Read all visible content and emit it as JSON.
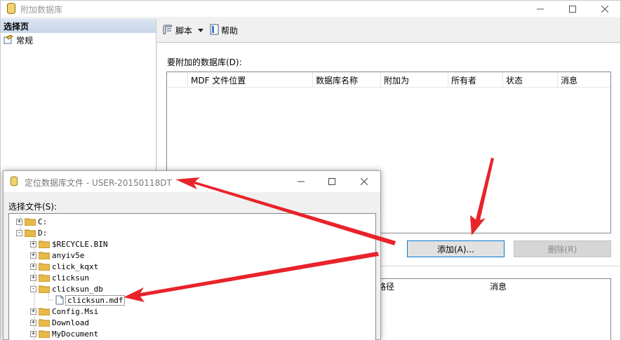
{
  "main_window": {
    "title": "附加数据库",
    "left_pane": {
      "header": "选择页",
      "items": [
        {
          "label": "常规",
          "icon": "general-page-icon"
        }
      ]
    },
    "toolbar": {
      "script_label": "脚本",
      "help_label": "帮助"
    },
    "db_section_label": "要附加的数据库(D):",
    "columns": [
      "MDF 文件位置",
      "数据库名称",
      "附加为",
      "所有者",
      "状态",
      "消息"
    ],
    "add_button": "添加(A)...",
    "remove_button": "删除(R)",
    "detail_columns": [
      "路径",
      "消息"
    ]
  },
  "dialog": {
    "title": "定位数据库文件 - USER-20150118DT",
    "select_label": "选择文件(S):",
    "tree": [
      {
        "label": "C:",
        "expander": "+",
        "type": "folder"
      },
      {
        "label": "D:",
        "expander": "-",
        "type": "folder"
      },
      {
        "label": "$RECYCLE.BIN",
        "expander": "+",
        "type": "folder"
      },
      {
        "label": "anyiv5e",
        "expander": "+",
        "type": "folder"
      },
      {
        "label": "click_kqxt",
        "expander": "+",
        "type": "folder"
      },
      {
        "label": "clicksun",
        "expander": "+",
        "type": "folder"
      },
      {
        "label": "clicksun_db",
        "expander": "-",
        "type": "folder"
      },
      {
        "label": "clicksun.mdf",
        "expander": "",
        "type": "file",
        "selected": true
      },
      {
        "label": "Config.Msi",
        "expander": "+",
        "type": "folder"
      },
      {
        "label": "Download",
        "expander": "+",
        "type": "folder"
      },
      {
        "label": "MyDocument",
        "expander": "+",
        "type": "folder"
      }
    ]
  },
  "colors": {
    "annotation_arrow": "#e8232a",
    "focus_border": "#0078d7",
    "folder": "#e9b949"
  },
  "annotation_arrows": 3
}
